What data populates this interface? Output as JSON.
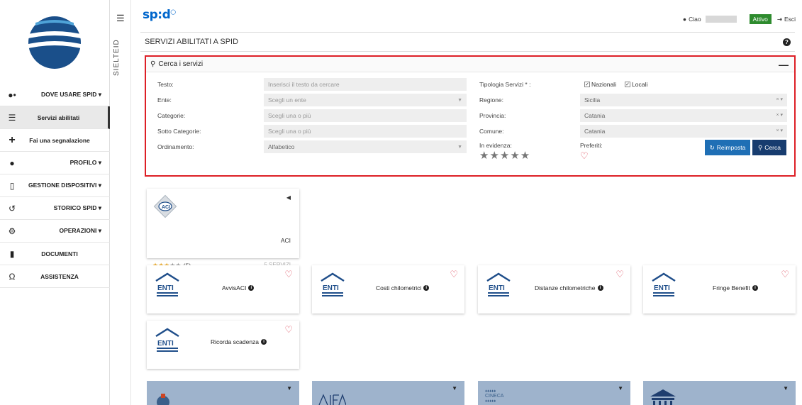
{
  "sidebar": {
    "items": [
      {
        "label": "DOVE USARE SPID ▾",
        "icon": "users-icon"
      },
      {
        "label": "Servizi abilitati",
        "icon": "list-icon",
        "active": true
      },
      {
        "label": "Fai una segnalazione",
        "icon": "plus-icon"
      },
      {
        "label": "PROFILO ▾",
        "icon": "user-icon"
      },
      {
        "label": "GESTIONE DISPOSITIVI ▾",
        "icon": "mobile-icon"
      },
      {
        "label": "STORICO SPID ▾",
        "icon": "history-icon"
      },
      {
        "label": "OPERAZIONI ▾",
        "icon": "cogs-icon"
      },
      {
        "label": "DOCUMENTI",
        "icon": "book-icon"
      },
      {
        "label": "ASSISTENZA",
        "icon": "headset-icon"
      }
    ]
  },
  "vertical_label": "SIELTEID",
  "topbar": {
    "brand": "sp:d",
    "greeting": "Ciao",
    "status": "Attivo",
    "exit": "Esci"
  },
  "page": {
    "title": "SERVIZI ABILITATI A SPID"
  },
  "search": {
    "title": "Cerca i servizi",
    "fields": {
      "testo_label": "Testo:",
      "testo_placeholder": "Inserisci il testo da cercare",
      "ente_label": "Ente:",
      "ente_placeholder": "Scegli un ente",
      "categorie_label": "Categorie:",
      "categorie_placeholder": "Scegli una o più",
      "sottocat_label": "Sotto Categorie:",
      "sottocat_placeholder": "Scegli una o più",
      "ordinamento_label": "Ordinamento:",
      "ordinamento_value": "Alfabetico",
      "tipologia_label": "Tipologia Servizi * :",
      "nazionali": "Nazionali",
      "locali": "Locali",
      "regione_label": "Regione:",
      "regione_value": "Sicilia",
      "provincia_label": "Provincia:",
      "provincia_value": "Catania",
      "comune_label": "Comune:",
      "comune_value": "Catania",
      "evidenza_label": "In evidenza:",
      "evidenza_stars": "★★★★★",
      "preferiti_label": "Preferiti:"
    },
    "reset_label": "Reimposta",
    "search_label": "Cerca"
  },
  "aci": {
    "name": "ACI",
    "rating_text": "(5)",
    "rating": 3,
    "services": "5 SERVIZI"
  },
  "services": [
    {
      "name": "AvvisACI"
    },
    {
      "name": "Costi chilometrici"
    },
    {
      "name": "Distanze chilometriche"
    },
    {
      "name": "Fringe Benefit"
    },
    {
      "name": "Ricorda scadenza"
    }
  ],
  "enti_label": "ENTI",
  "colors": {
    "accent": "#0066cc",
    "highlight_border": "#dd1f26",
    "status": "#2e8b2e",
    "reset_button": "#1f6fb5",
    "search_button": "#173c6f"
  }
}
